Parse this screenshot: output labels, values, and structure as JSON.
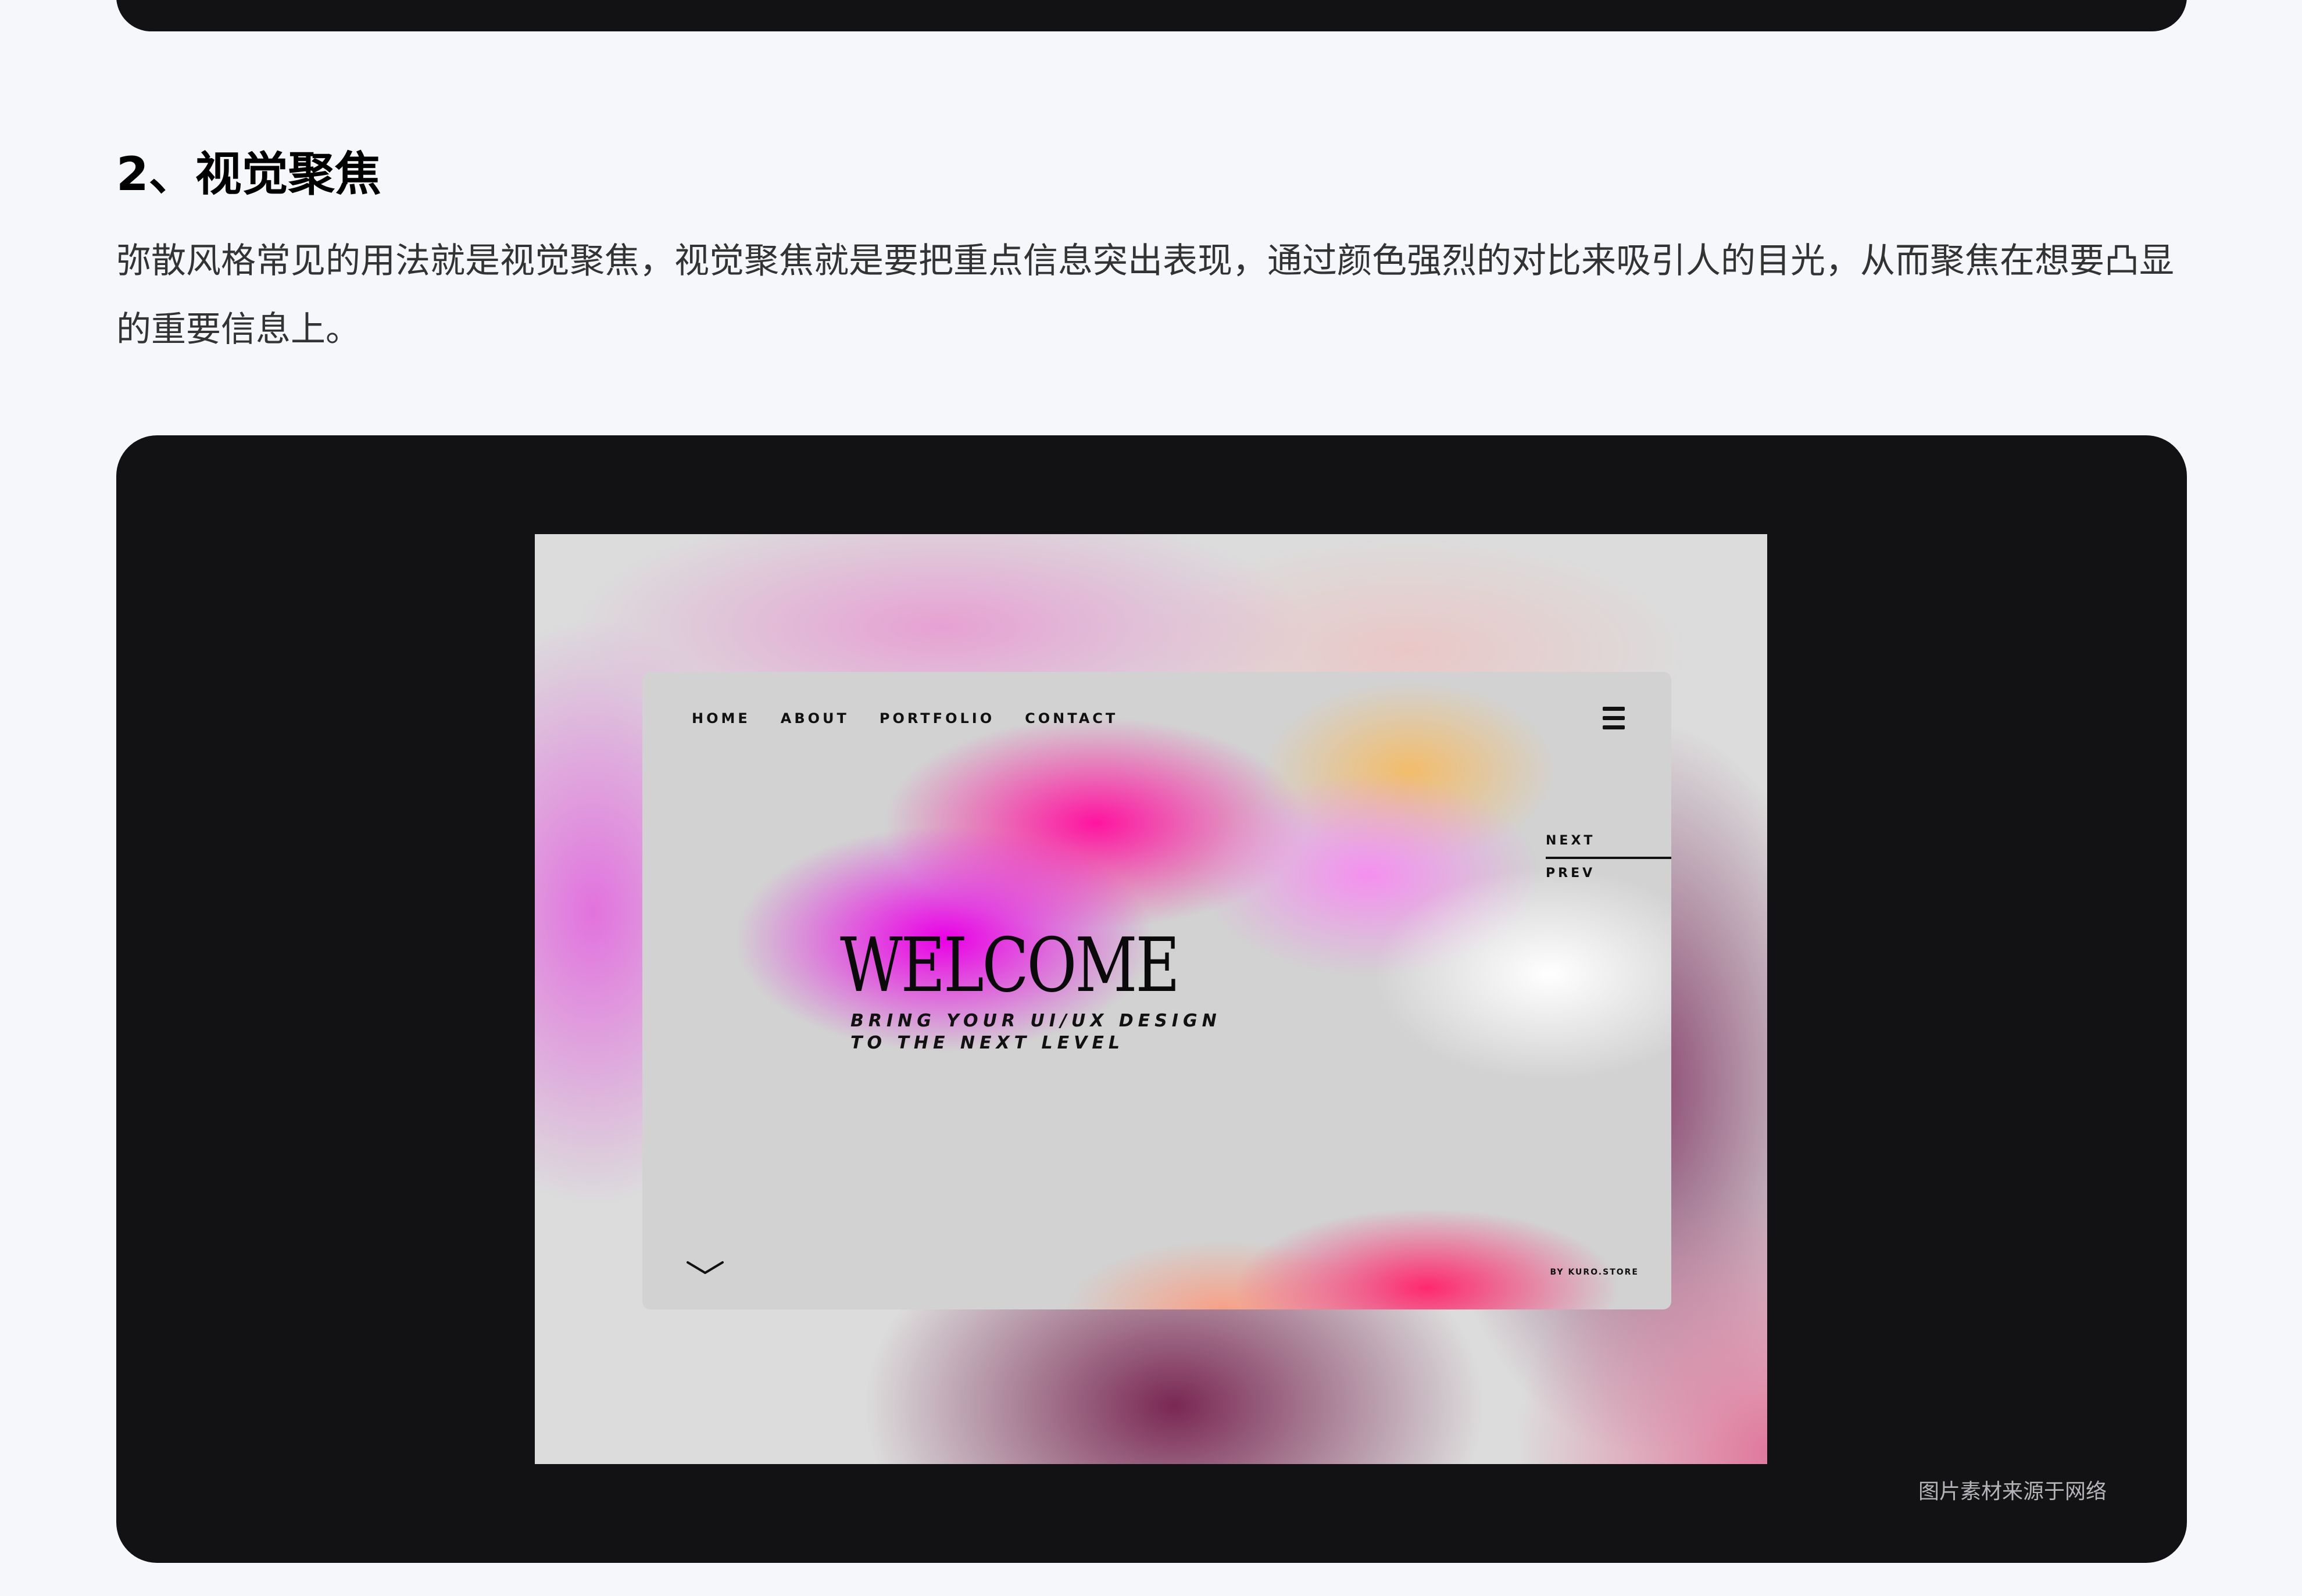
{
  "section": {
    "heading": "2、视觉聚焦",
    "paragraph": "弥散风格常见的用法就是视觉聚焦，视觉聚焦就是要把重点信息突出表现，通过颜色强烈的对比来吸引人的目光，从而聚焦在想要凸显的重要信息上。",
    "caption": "图片素材来源于网络"
  },
  "mockup": {
    "nav": [
      "HOME",
      "ABOUT",
      "PORTFOLIO",
      "CONTACT"
    ],
    "menu_icon": "hamburger-icon",
    "next": "NEXT",
    "prev": "PREV",
    "title": "WELCOME",
    "tagline_line1": "BRING YOUR UI/UX DESIGN",
    "tagline_line2": "TO THE NEXT LEVEL",
    "scroll_icon": "chevron-down-icon",
    "credit": "BY KURO.STORE"
  },
  "colors": {
    "page_bg": "#f6f7fb",
    "panel_bg": "#121214",
    "accent_magenta": "#ea00e6",
    "accent_pink": "#ff2870"
  }
}
